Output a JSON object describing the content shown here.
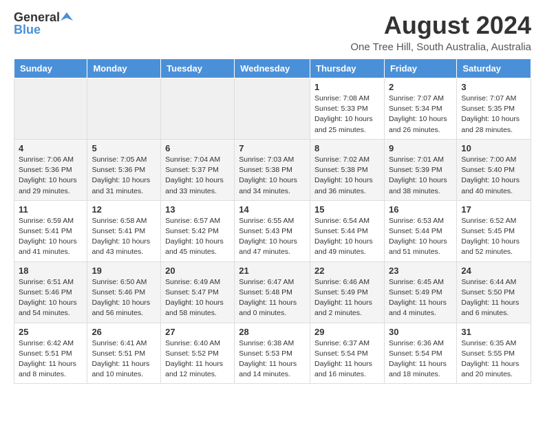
{
  "header": {
    "logo_general": "General",
    "logo_blue": "Blue",
    "month_year": "August 2024",
    "location": "One Tree Hill, South Australia, Australia"
  },
  "days_of_week": [
    "Sunday",
    "Monday",
    "Tuesday",
    "Wednesday",
    "Thursday",
    "Friday",
    "Saturday"
  ],
  "weeks": [
    [
      {
        "num": "",
        "empty": true
      },
      {
        "num": "",
        "empty": true
      },
      {
        "num": "",
        "empty": true
      },
      {
        "num": "",
        "empty": true
      },
      {
        "num": "1",
        "sunrise": "7:08 AM",
        "sunset": "5:33 PM",
        "daylight": "10 hours and 25 minutes."
      },
      {
        "num": "2",
        "sunrise": "7:07 AM",
        "sunset": "5:34 PM",
        "daylight": "10 hours and 26 minutes."
      },
      {
        "num": "3",
        "sunrise": "7:07 AM",
        "sunset": "5:35 PM",
        "daylight": "10 hours and 28 minutes."
      }
    ],
    [
      {
        "num": "4",
        "sunrise": "7:06 AM",
        "sunset": "5:36 PM",
        "daylight": "10 hours and 29 minutes."
      },
      {
        "num": "5",
        "sunrise": "7:05 AM",
        "sunset": "5:36 PM",
        "daylight": "10 hours and 31 minutes."
      },
      {
        "num": "6",
        "sunrise": "7:04 AM",
        "sunset": "5:37 PM",
        "daylight": "10 hours and 33 minutes."
      },
      {
        "num": "7",
        "sunrise": "7:03 AM",
        "sunset": "5:38 PM",
        "daylight": "10 hours and 34 minutes."
      },
      {
        "num": "8",
        "sunrise": "7:02 AM",
        "sunset": "5:38 PM",
        "daylight": "10 hours and 36 minutes."
      },
      {
        "num": "9",
        "sunrise": "7:01 AM",
        "sunset": "5:39 PM",
        "daylight": "10 hours and 38 minutes."
      },
      {
        "num": "10",
        "sunrise": "7:00 AM",
        "sunset": "5:40 PM",
        "daylight": "10 hours and 40 minutes."
      }
    ],
    [
      {
        "num": "11",
        "sunrise": "6:59 AM",
        "sunset": "5:41 PM",
        "daylight": "10 hours and 41 minutes."
      },
      {
        "num": "12",
        "sunrise": "6:58 AM",
        "sunset": "5:41 PM",
        "daylight": "10 hours and 43 minutes."
      },
      {
        "num": "13",
        "sunrise": "6:57 AM",
        "sunset": "5:42 PM",
        "daylight": "10 hours and 45 minutes."
      },
      {
        "num": "14",
        "sunrise": "6:55 AM",
        "sunset": "5:43 PM",
        "daylight": "10 hours and 47 minutes."
      },
      {
        "num": "15",
        "sunrise": "6:54 AM",
        "sunset": "5:44 PM",
        "daylight": "10 hours and 49 minutes."
      },
      {
        "num": "16",
        "sunrise": "6:53 AM",
        "sunset": "5:44 PM",
        "daylight": "10 hours and 51 minutes."
      },
      {
        "num": "17",
        "sunrise": "6:52 AM",
        "sunset": "5:45 PM",
        "daylight": "10 hours and 52 minutes."
      }
    ],
    [
      {
        "num": "18",
        "sunrise": "6:51 AM",
        "sunset": "5:46 PM",
        "daylight": "10 hours and 54 minutes."
      },
      {
        "num": "19",
        "sunrise": "6:50 AM",
        "sunset": "5:46 PM",
        "daylight": "10 hours and 56 minutes."
      },
      {
        "num": "20",
        "sunrise": "6:49 AM",
        "sunset": "5:47 PM",
        "daylight": "10 hours and 58 minutes."
      },
      {
        "num": "21",
        "sunrise": "6:47 AM",
        "sunset": "5:48 PM",
        "daylight": "11 hours and 0 minutes."
      },
      {
        "num": "22",
        "sunrise": "6:46 AM",
        "sunset": "5:49 PM",
        "daylight": "11 hours and 2 minutes."
      },
      {
        "num": "23",
        "sunrise": "6:45 AM",
        "sunset": "5:49 PM",
        "daylight": "11 hours and 4 minutes."
      },
      {
        "num": "24",
        "sunrise": "6:44 AM",
        "sunset": "5:50 PM",
        "daylight": "11 hours and 6 minutes."
      }
    ],
    [
      {
        "num": "25",
        "sunrise": "6:42 AM",
        "sunset": "5:51 PM",
        "daylight": "11 hours and 8 minutes."
      },
      {
        "num": "26",
        "sunrise": "6:41 AM",
        "sunset": "5:51 PM",
        "daylight": "11 hours and 10 minutes."
      },
      {
        "num": "27",
        "sunrise": "6:40 AM",
        "sunset": "5:52 PM",
        "daylight": "11 hours and 12 minutes."
      },
      {
        "num": "28",
        "sunrise": "6:38 AM",
        "sunset": "5:53 PM",
        "daylight": "11 hours and 14 minutes."
      },
      {
        "num": "29",
        "sunrise": "6:37 AM",
        "sunset": "5:54 PM",
        "daylight": "11 hours and 16 minutes."
      },
      {
        "num": "30",
        "sunrise": "6:36 AM",
        "sunset": "5:54 PM",
        "daylight": "11 hours and 18 minutes."
      },
      {
        "num": "31",
        "sunrise": "6:35 AM",
        "sunset": "5:55 PM",
        "daylight": "11 hours and 20 minutes."
      }
    ]
  ]
}
